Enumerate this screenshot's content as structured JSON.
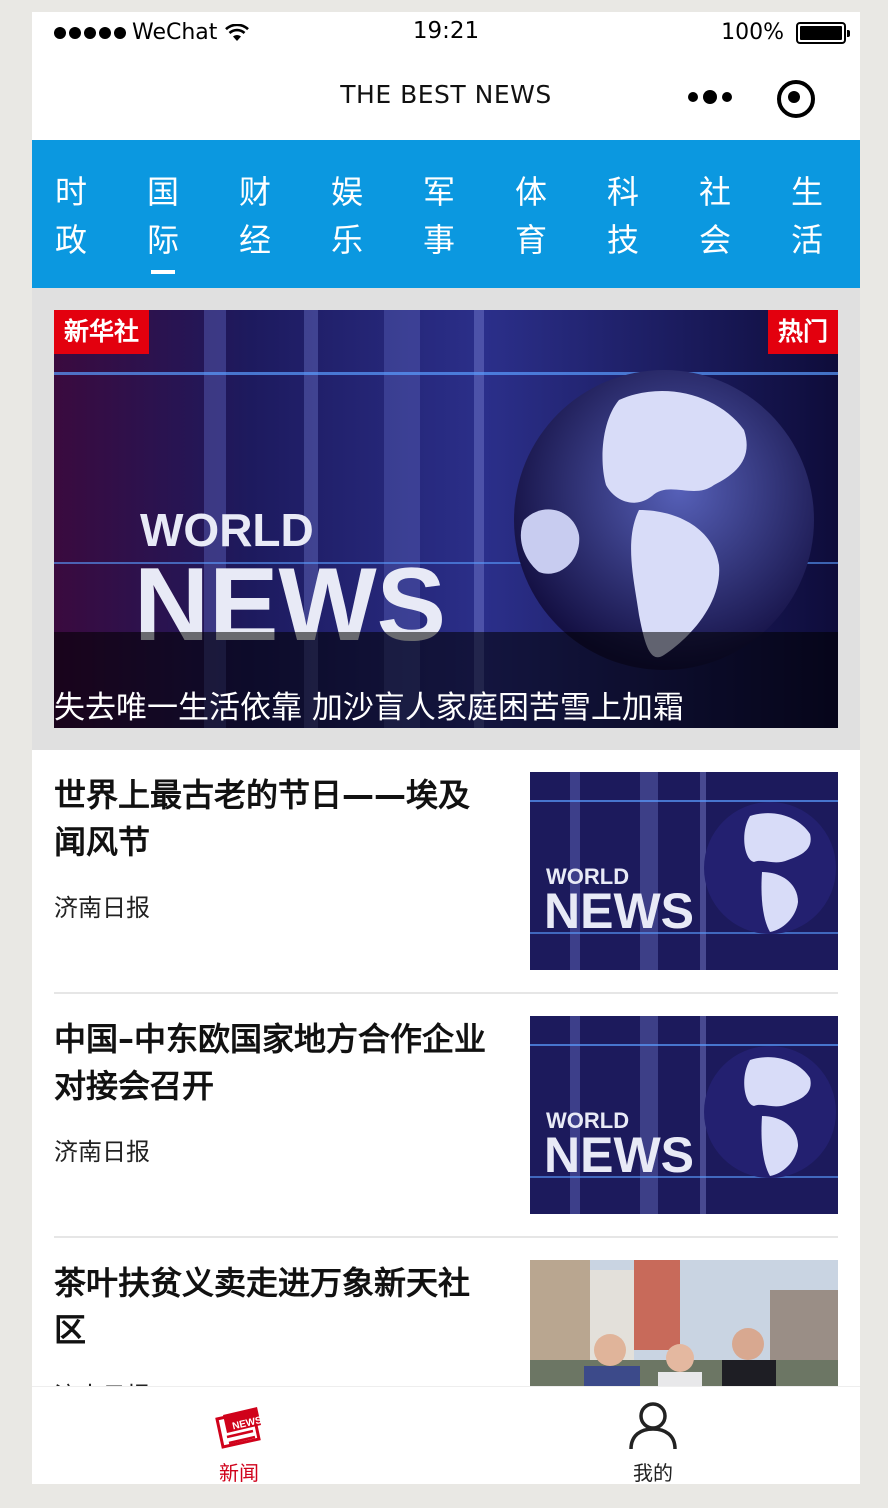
{
  "status_bar": {
    "carrier": "WeChat",
    "time": "19:21",
    "battery": "100%"
  },
  "navbar": {
    "title": "THE BEST NEWS"
  },
  "tabs": [
    {
      "label_top": "时",
      "label_bottom": "政",
      "active": false
    },
    {
      "label_top": "国",
      "label_bottom": "际",
      "active": true
    },
    {
      "label_top": "财",
      "label_bottom": "经",
      "active": false
    },
    {
      "label_top": "娱",
      "label_bottom": "乐",
      "active": false
    },
    {
      "label_top": "军",
      "label_bottom": "事",
      "active": false
    },
    {
      "label_top": "体",
      "label_bottom": "育",
      "active": false
    },
    {
      "label_top": "科",
      "label_bottom": "技",
      "active": false
    },
    {
      "label_top": "社",
      "label_bottom": "会",
      "active": false
    },
    {
      "label_top": "生",
      "label_bottom": "活",
      "active": false
    }
  ],
  "banner": {
    "source_tag": "新华社",
    "hot_tag": "热门",
    "image_text_top": "WORLD",
    "image_text_bottom": "NEWS",
    "caption": "失去唯一生活依靠 加沙盲人家庭困苦雪上加霜"
  },
  "news": [
    {
      "title": "世界上最古老的节日——埃及闻风节",
      "source": "济南日报",
      "thumb_text_top": "WORLD",
      "thumb_text_bottom": "NEWS"
    },
    {
      "title": "中国–中东欧国家地方合作企业对接会召开",
      "source": "济南日报",
      "thumb_text_top": "WORLD",
      "thumb_text_bottom": "NEWS"
    },
    {
      "title": "茶叶扶贫义卖走进万象新天社区",
      "source": "济南日报"
    }
  ],
  "tabbar": {
    "news_label": "新闻",
    "news_icon_text": "NEWS",
    "mine_label": "我的"
  },
  "colors": {
    "accent_blue": "#0b98e0",
    "tag_red": "#e3000e",
    "tabbar_active": "#d0021b"
  }
}
